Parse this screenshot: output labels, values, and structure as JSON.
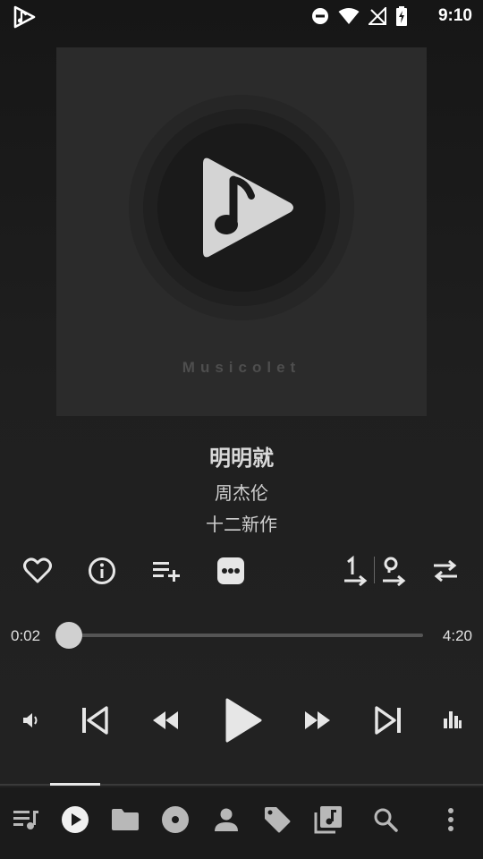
{
  "status_bar": {
    "time": "9:10"
  },
  "album_art": {
    "wordmark": "Musicolet"
  },
  "track": {
    "title": "明明就",
    "artist": "周杰伦",
    "album": "十二新作"
  },
  "progress": {
    "elapsed": "0:02",
    "total": "4:20",
    "fraction": 0.008
  },
  "actions": [
    "heart-icon",
    "info-icon",
    "add-to-queue-icon",
    "more-icon",
    "repeat-one-icon",
    "stop-after-queue-icon",
    "repeat-icon"
  ],
  "controls": [
    "volume-icon",
    "skip-previous-icon",
    "rewind-icon",
    "play-icon",
    "fast-forward-icon",
    "skip-next-icon",
    "equalizer-icon"
  ],
  "bottom_nav": [
    "queue",
    "now-playing",
    "folders",
    "albums",
    "artists",
    "genres",
    "playlists",
    "search",
    "menu"
  ],
  "colors": {
    "accent": "#e8e8e8",
    "background": "#1f1f1f"
  }
}
